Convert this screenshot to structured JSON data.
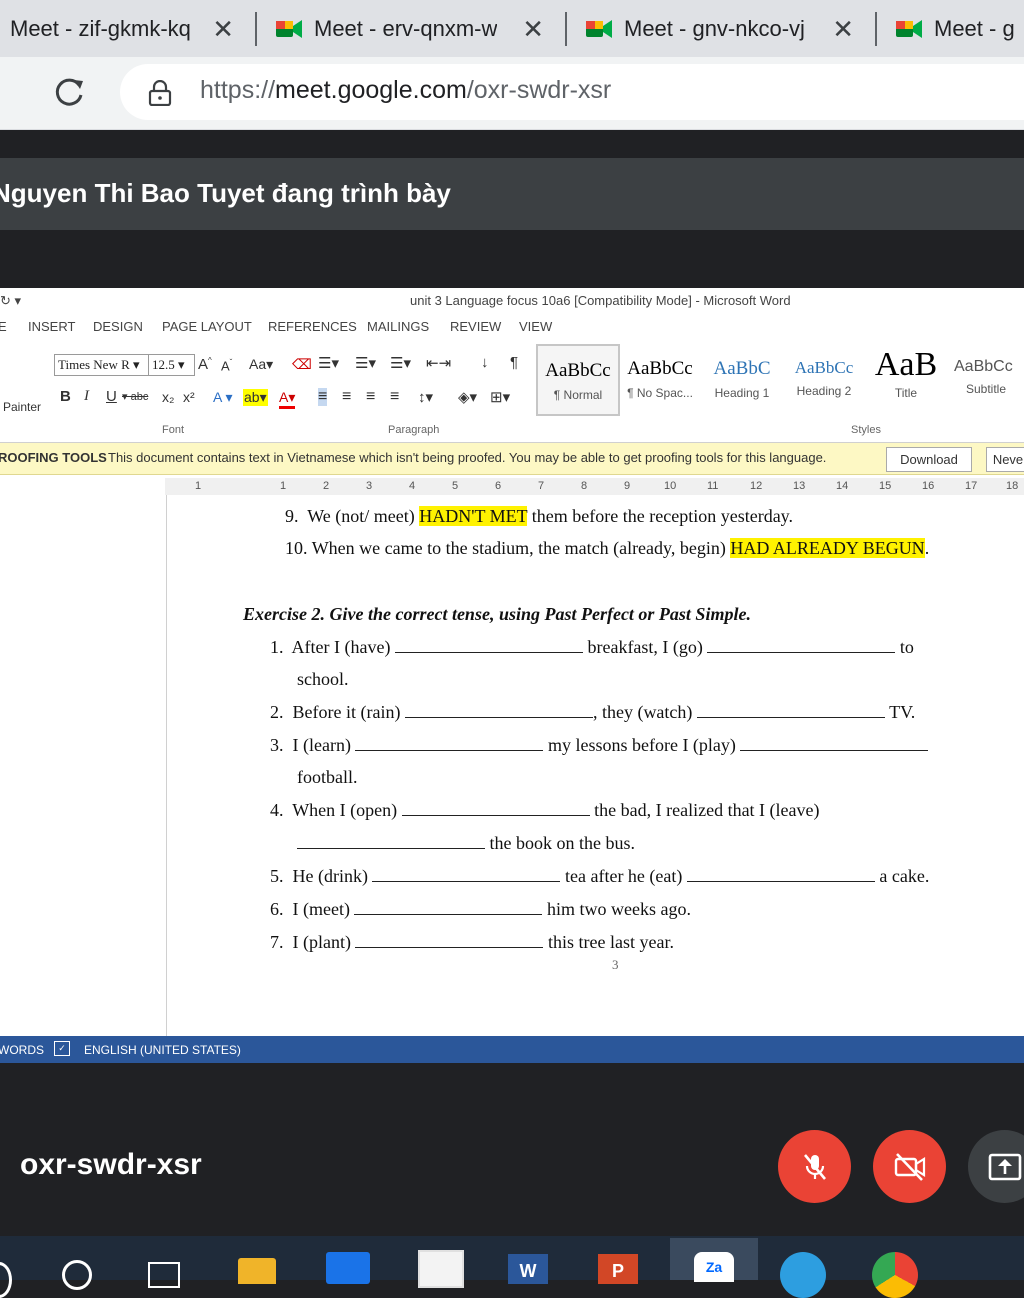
{
  "browser": {
    "tabs": [
      {
        "title": "Meet - zif-gkmk-kq"
      },
      {
        "title": "Meet - erv-qnxm-w"
      },
      {
        "title": "Meet - gnv-nkco-vj"
      },
      {
        "title": "Meet - g"
      }
    ],
    "url_scheme": "https://",
    "url_host": "meet.google.com",
    "url_path": "/oxr-swdr-xsr"
  },
  "meet": {
    "presenter_text": "Nguyen Thi Bao Tuyet đang trình bày",
    "meeting_code": "oxr-swdr-xsr",
    "colors": {
      "accent_red": "#ea4335",
      "dark_bg": "#202124"
    }
  },
  "word": {
    "title": "unit 3 Language focus 10a6 [Compatibility Mode] - Microsoft Word",
    "menu": [
      "E",
      "INSERT",
      "DESIGN",
      "PAGE LAYOUT",
      "REFERENCES",
      "MAILINGS",
      "REVIEW",
      "VIEW"
    ],
    "font_name": "Times New R",
    "font_size": "12.5",
    "painter_label": "Painter",
    "groups": {
      "font": "Font",
      "paragraph": "Paragraph",
      "styles": "Styles"
    },
    "styles": [
      {
        "preview": "AaBbCc",
        "name": "¶ Normal"
      },
      {
        "preview": "AaBbCc",
        "name": "¶ No Spac..."
      },
      {
        "preview": "AaBbC",
        "name": "Heading 1"
      },
      {
        "preview": "AaBbCc",
        "name": "Heading 2"
      },
      {
        "preview": "AaB",
        "name": "Title"
      },
      {
        "preview": "AaBbCc",
        "name": "Subtitle"
      }
    ],
    "proofing": {
      "head": "ROOFING TOOLS",
      "message": "This document contains text in Vietnamese which isn't being proofed. You may be able to get proofing tools for this language.",
      "download": "Download",
      "never": "Neve"
    },
    "ruler": [
      "1",
      "1",
      "2",
      "3",
      "4",
      "5",
      "6",
      "7",
      "8",
      "9",
      "10",
      "11",
      "12",
      "13",
      "14",
      "15",
      "16",
      "17",
      "18"
    ],
    "status": {
      "words": "WORDS",
      "language": "ENGLISH (UNITED STATES)"
    }
  },
  "doc": {
    "q9": {
      "num": "9.",
      "pre": "We (not/ meet)",
      "ans": "HADN'T MET",
      "post": "them before the reception yesterday."
    },
    "q10": {
      "num": "10.",
      "pre": "When we came to the stadium, the match (already, begin)",
      "ans": "HAD ALREADY BEGUN",
      "post": "."
    },
    "exercise": "Exercise 2. Give the correct tense, using Past Perfect or Past Simple.",
    "items": [
      {
        "num": "1.",
        "a": "After I (have)",
        "b": "breakfast, I (go)",
        "c": "to",
        "cont": "school."
      },
      {
        "num": "2.",
        "a": "Before it (rain)",
        "b": ", they (watch)",
        "c": "TV."
      },
      {
        "num": "3.",
        "a": "I (learn)",
        "b": "my lessons before I (play)",
        "cont": "football."
      },
      {
        "num": "4.",
        "a": "When I (open)",
        "b": "the bad, I realized that I (leave)",
        "cont": "the book on the bus."
      },
      {
        "num": "5.",
        "a": "He (drink)",
        "b": "tea after he (eat)",
        "c": "a cake."
      },
      {
        "num": "6.",
        "a": "I (meet)",
        "b": "him two weeks ago."
      },
      {
        "num": "7.",
        "a": "I (plant)",
        "b": "this tree last year."
      }
    ],
    "page_number": "3"
  }
}
